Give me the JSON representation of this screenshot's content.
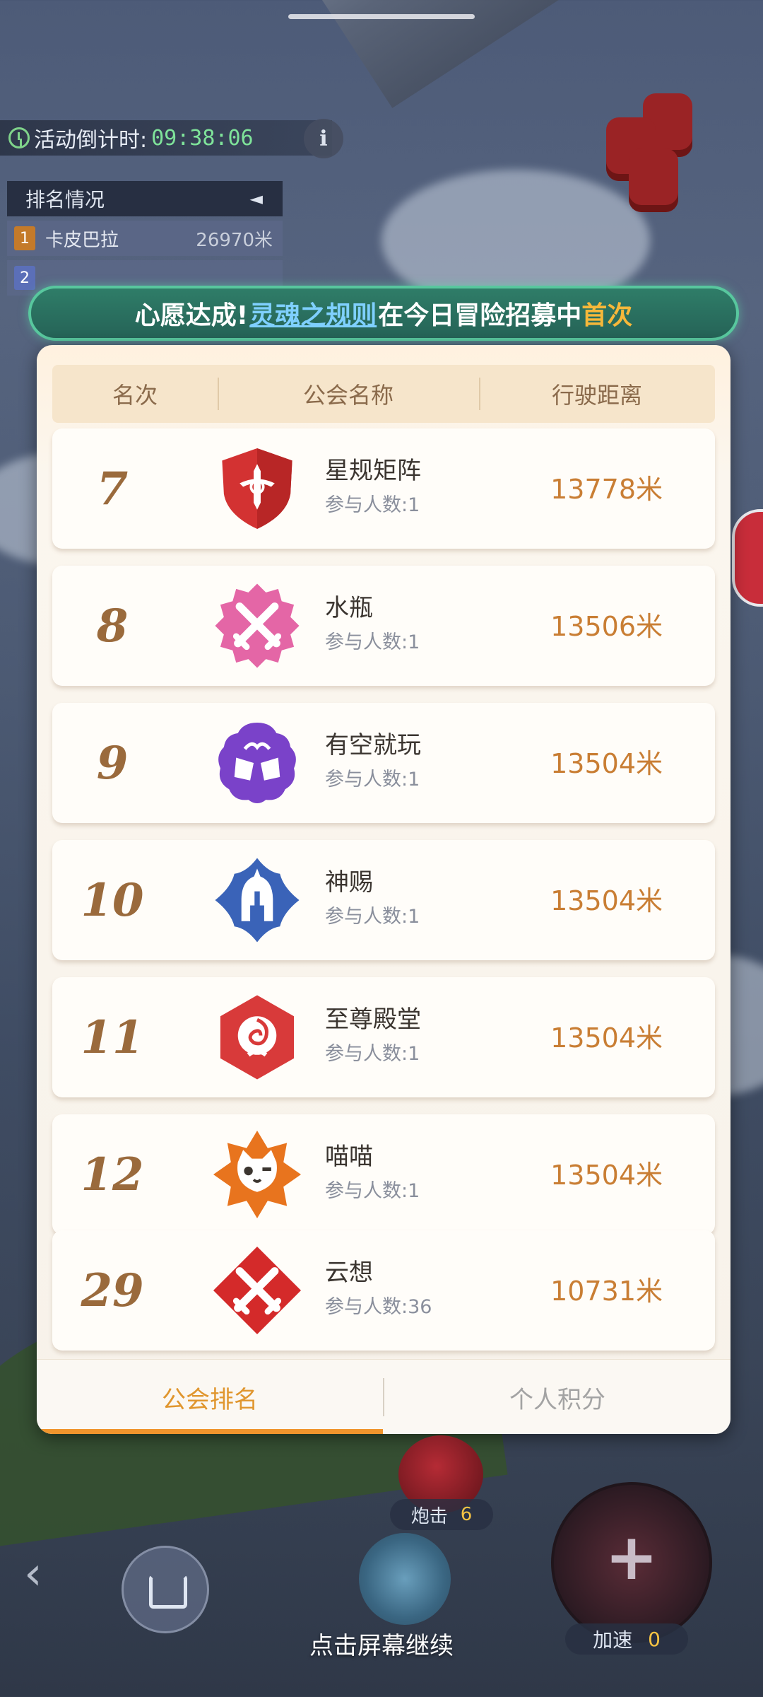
{
  "hud": {
    "countdown_label": "活动倒计时:",
    "countdown_value": "09:38:06",
    "info_icon": "i",
    "rank_panel": {
      "title": "排名情况",
      "collapse_glyph": "◄",
      "rows": [
        {
          "rank": "1",
          "name": "卡皮巴拉",
          "distance": "26970米"
        },
        {
          "rank": "2",
          "name": "",
          "distance": ""
        }
      ]
    },
    "cannon_label": "炮击",
    "cannon_count": "6",
    "boost_label": "加速",
    "boost_count": "0",
    "continue_hint": "点击屏幕继续"
  },
  "banner": {
    "prefix": "心愿达成!",
    "link": "灵魂之规则",
    "middle": "在今日冒险招募中",
    "highlight": "首次"
  },
  "table": {
    "headers": [
      "名次",
      "公会名称",
      "行驶距离"
    ],
    "rows": [
      {
        "rank": "7",
        "name": "星规矩阵",
        "members": "参与人数:1",
        "distance": "13778米",
        "emblem_icon": "shield-sword-emblem-icon",
        "emblem_color": "#d33232"
      },
      {
        "rank": "8",
        "name": "水瓶",
        "members": "参与人数:1",
        "distance": "13506米",
        "emblem_icon": "crossed-swords-emblem-icon",
        "emblem_color": "#e466a6"
      },
      {
        "rank": "9",
        "name": "有空就玩",
        "members": "参与人数:1",
        "distance": "13504米",
        "emblem_icon": "cheers-mugs-emblem-icon",
        "emblem_color": "#7a42c9"
      },
      {
        "rank": "10",
        "name": "神赐",
        "members": "参与人数:1",
        "distance": "13504米",
        "emblem_icon": "spartan-helmet-emblem-icon",
        "emblem_color": "#3a63b8"
      },
      {
        "rank": "11",
        "name": "至尊殿堂",
        "members": "参与人数:1",
        "distance": "13504米",
        "emblem_icon": "rose-emblem-icon",
        "emblem_color": "#d83a3a"
      },
      {
        "rank": "12",
        "name": "喵喵",
        "members": "参与人数:1",
        "distance": "13504米",
        "emblem_icon": "cat-emblem-icon",
        "emblem_color": "#e8741e"
      },
      {
        "rank": "29",
        "name": "云想",
        "members": "参与人数:36",
        "distance": "10731米",
        "emblem_icon": "crossed-swords-emblem-icon",
        "emblem_color": "#d42a2a"
      }
    ]
  },
  "tabs": [
    {
      "label": "公会排名",
      "active": true
    },
    {
      "label": "个人积分",
      "active": false
    }
  ],
  "colors": {
    "accent": "#f0952d",
    "distance": "#c97e34",
    "banner_link": "#7fd0ff",
    "banner_highlight": "#f6b83a",
    "countdown": "#7fe39a"
  }
}
